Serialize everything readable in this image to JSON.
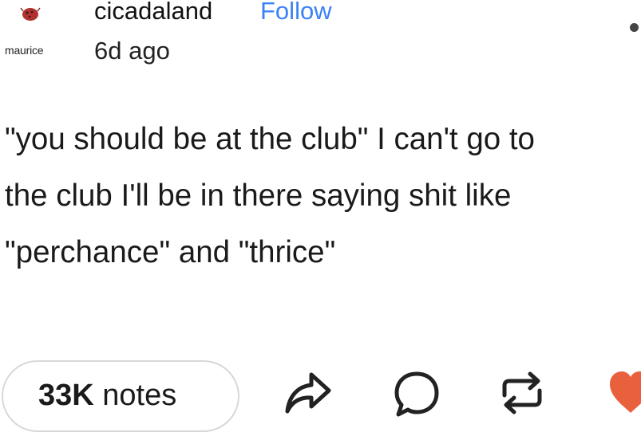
{
  "post": {
    "author": {
      "username": "cicadaland",
      "avatar_caption": "maurice",
      "avatar_icon": "ladybug-icon"
    },
    "follow_label": "Follow",
    "timestamp": "6d ago",
    "body_lines": [
      "\"you should be at the club\" I can't go to",
      "the club I'll be in there saying shit like",
      "\"perchance\" and \"thrice\""
    ]
  },
  "footer": {
    "notes_count": "33K",
    "notes_label": "notes",
    "actions": [
      {
        "name": "share",
        "icon": "share-icon"
      },
      {
        "name": "reply",
        "icon": "reply-icon"
      },
      {
        "name": "reblog",
        "icon": "reblog-icon"
      },
      {
        "name": "like",
        "icon": "heart-icon"
      }
    ]
  },
  "colors": {
    "follow": "#3b82f6",
    "like": "#e8603c",
    "avatar": "#b0312f",
    "text": "#111111"
  },
  "more_menu_icon": "more-dot-icon"
}
